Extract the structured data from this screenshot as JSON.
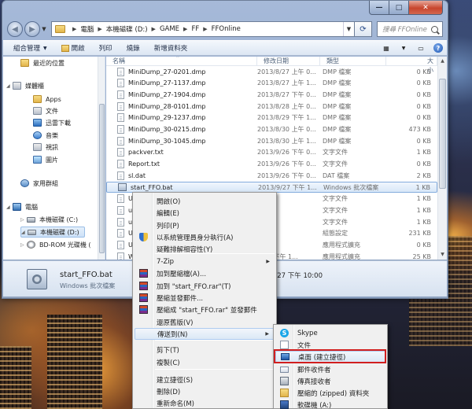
{
  "window": {
    "controls": {
      "minimize": "—",
      "maximize": "□",
      "close": "✕"
    },
    "breadcrumb": [
      "電腦",
      "本機磁碟 (D:)",
      "GAME",
      "FF",
      "FFOnline"
    ],
    "search_placeholder": "搜尋 FFOnline"
  },
  "toolbar": {
    "items": [
      "組合管理",
      "開啟",
      "列印",
      "燒錄",
      "新增資料夾"
    ]
  },
  "navpane": {
    "items": [
      {
        "label": "最近的位置",
        "icon": "recent-places-icon"
      },
      {
        "label": "媒體櫃",
        "icon": "libraries-icon"
      },
      {
        "label": "Apps",
        "icon": "folder-icon"
      },
      {
        "label": "文件",
        "icon": "documents-icon"
      },
      {
        "label": "迅雷下載",
        "icon": "folder-icon"
      },
      {
        "label": "音樂",
        "icon": "music-icon"
      },
      {
        "label": "視訊",
        "icon": "videos-icon"
      },
      {
        "label": "圖片",
        "icon": "pictures-icon"
      },
      {
        "label": "家用群組",
        "icon": "homegroup-icon"
      },
      {
        "label": "電腦",
        "icon": "computer-icon"
      },
      {
        "label": "本機磁碟 (C:)",
        "icon": "drive-icon"
      },
      {
        "label": "本機磁碟 (D:)",
        "icon": "drive-icon",
        "selected": true
      },
      {
        "label": "BD-ROM 光碟機 (",
        "icon": "cd-drive-icon"
      }
    ]
  },
  "filelist": {
    "columns": [
      "名稱",
      "修改日期",
      "類型",
      "大小"
    ],
    "rows": [
      {
        "name": "MiniDump_27-0201.dmp",
        "date": "2013/8/27 上午 0...",
        "type": "DMP 檔案",
        "size": "0 KB"
      },
      {
        "name": "MiniDump_27-1137.dmp",
        "date": "2013/8/27 上午 1...",
        "type": "DMP 檔案",
        "size": "0 KB"
      },
      {
        "name": "MiniDump_27-1904.dmp",
        "date": "2013/8/27 下午 0...",
        "type": "DMP 檔案",
        "size": "0 KB"
      },
      {
        "name": "MiniDump_28-0101.dmp",
        "date": "2013/8/28 上午 0...",
        "type": "DMP 檔案",
        "size": "0 KB"
      },
      {
        "name": "MiniDump_29-1237.dmp",
        "date": "2013/8/29 下午 1...",
        "type": "DMP 檔案",
        "size": "0 KB"
      },
      {
        "name": "MiniDump_30-0215.dmp",
        "date": "2013/8/30 上午 0...",
        "type": "DMP 檔案",
        "size": "473 KB"
      },
      {
        "name": "MiniDump_30-1045.dmp",
        "date": "2013/8/30 上午 1...",
        "type": "DMP 檔案",
        "size": "0 KB"
      },
      {
        "name": "packver.txt",
        "date": "2013/9/26 下午 0...",
        "type": "文字文件",
        "size": "1 KB"
      },
      {
        "name": "Report.txt",
        "date": "2013/9/26 下午 0...",
        "type": "文字文件",
        "size": "0 KB"
      },
      {
        "name": "sl.dat",
        "date": "2013/9/26 下午 0...",
        "type": "DAT 檔案",
        "size": "2 KB"
      },
      {
        "name": "start_FFO.bat",
        "date": "2013/9/27 下午 1...",
        "type": "Windows 批次檔案",
        "size": "1 KB",
        "selected": true
      },
      {
        "name": "U",
        "date": "",
        "type": "文字文件",
        "size": "1 KB"
      },
      {
        "name": "up",
        "date": "",
        "type": "文字文件",
        "size": "1 KB"
      },
      {
        "name": "up",
        "date": "",
        "type": "文字文件",
        "size": "1 KB"
      },
      {
        "name": "U",
        "date": "",
        "type": "組態設定",
        "size": "231 KB"
      },
      {
        "name": "U",
        "date": "",
        "type": "應用程式擴充",
        "size": "0 KB"
      },
      {
        "name": "W",
        "date": "9/27 下午 1...",
        "type": "應用程式擴充",
        "size": "25 KB"
      }
    ]
  },
  "details": {
    "name": "start_FFO.bat",
    "type": "Windows 批次檔案",
    "modified": "9/27 下午 10:00"
  },
  "context_menu": {
    "items": [
      {
        "label": "開啟(O)",
        "icon": ""
      },
      {
        "label": "編輯(E)",
        "icon": ""
      },
      {
        "label": "列印(P)",
        "icon": ""
      },
      {
        "label": "以系統管理員身分執行(A)",
        "icon": "uac-shield-icon"
      },
      {
        "label": "疑難排解相容性(Y)",
        "icon": ""
      },
      {
        "label": "7-Zip",
        "icon": "",
        "submenu": true
      },
      {
        "label": "加到壓縮檔(A)...",
        "icon": "winrar-icon"
      },
      {
        "label": "加到 \"start_FFO.rar\"(T)",
        "icon": "winrar-icon"
      },
      {
        "label": "壓縮並發郵件...",
        "icon": "winrar-icon"
      },
      {
        "label": "壓縮成 \"start_FFO.rar\" 並發郵件",
        "icon": "winrar-icon"
      },
      {
        "label": "還原舊版(V)",
        "icon": ""
      },
      {
        "label": "傳送到(N)",
        "icon": "",
        "submenu": true,
        "highlighted": true
      },
      {
        "label": "剪下(T)",
        "icon": ""
      },
      {
        "label": "複製(C)",
        "icon": ""
      },
      {
        "label": "建立捷徑(S)",
        "icon": ""
      },
      {
        "label": "刪除(D)",
        "icon": ""
      },
      {
        "label": "重新命名(M)",
        "icon": ""
      }
    ]
  },
  "send_to_menu": {
    "items": [
      {
        "label": "Skype",
        "icon": "skype-icon"
      },
      {
        "label": "文件",
        "icon": "documents-icon"
      },
      {
        "label": "桌面 (建立捷徑)",
        "icon": "desktop-icon",
        "highlighted": true
      },
      {
        "label": "郵件收件者",
        "icon": "mail-icon"
      },
      {
        "label": "傳真接收者",
        "icon": "fax-icon"
      },
      {
        "label": "壓縮的 (zipped) 資料夾",
        "icon": "zip-folder-icon"
      },
      {
        "label": "軟碟機 (A:)",
        "icon": "floppy-icon"
      }
    ]
  },
  "colors": {
    "selection": "#d8e7f8",
    "menu_bg": "#f0f0f0",
    "highlight_box": "#d11f1f",
    "close_button": "#c7452d"
  }
}
